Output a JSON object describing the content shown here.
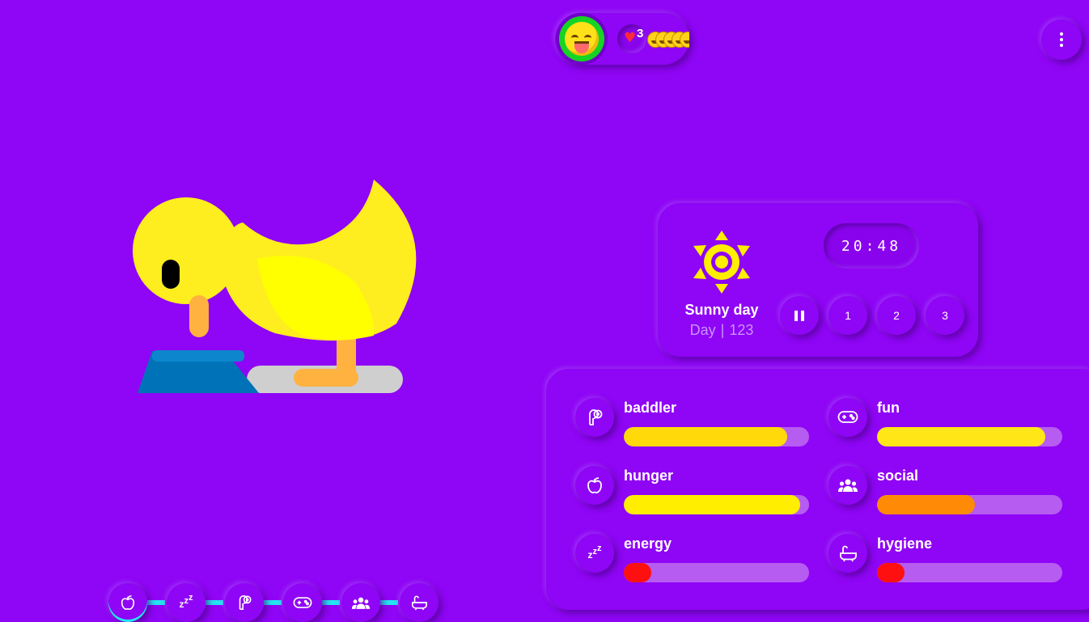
{
  "header": {
    "mood_icon": "grinning-tongue-face-icon",
    "heart_icon": "broken-heart-icon",
    "heart_count": "3",
    "companions_icon": "face-emoji-row-icon",
    "menu_icon": "vertical-dots-icon"
  },
  "pet": {
    "species": "duck",
    "action": "eating",
    "body_color": "#ffee1f",
    "wing_color": "#ffff00",
    "beak_color": "#ffb23f",
    "bowl_color": "#0073b8"
  },
  "weather": {
    "icon": "sun-icon",
    "name": "Sunny day",
    "day_label": "Day",
    "day_separator": "|",
    "day_number": "123",
    "clock": "20:48"
  },
  "speed_controls": {
    "pause_icon": "pause-icon",
    "speeds": [
      "1",
      "2",
      "3"
    ]
  },
  "stats": [
    {
      "key": "baddler",
      "label": "baddler",
      "icon": "toilet-paper-icon",
      "level": 0.88,
      "color": "#ffd90a"
    },
    {
      "key": "fun",
      "label": "fun",
      "icon": "gamepad-icon",
      "level": 0.91,
      "color": "#ffe617"
    },
    {
      "key": "hunger",
      "label": "hunger",
      "icon": "apple-icon",
      "level": 0.95,
      "color": "#ffee00"
    },
    {
      "key": "social",
      "label": "social",
      "icon": "group-icon",
      "level": 0.53,
      "color": "#ff8a05"
    },
    {
      "key": "energy",
      "label": "energy",
      "icon": "zzz-icon",
      "level": 0.15,
      "color": "#ff1010"
    },
    {
      "key": "hygiene",
      "label": "hygiene",
      "icon": "bathtub-icon",
      "level": 0.15,
      "color": "#ff1010"
    }
  ],
  "nav": [
    {
      "key": "hunger",
      "icon": "apple-icon",
      "active": true
    },
    {
      "key": "energy",
      "icon": "zzz-icon",
      "active": false
    },
    {
      "key": "baddler",
      "icon": "toilet-paper-icon",
      "active": false
    },
    {
      "key": "fun",
      "icon": "gamepad-icon",
      "active": false
    },
    {
      "key": "social",
      "icon": "group-icon",
      "active": false
    },
    {
      "key": "hygiene",
      "icon": "bathtub-icon",
      "active": false
    }
  ],
  "colors": {
    "background": "#8f05f5",
    "nav_accent": "#22e6f2",
    "bar_track": "#b65cf0",
    "secondary_text": "#c993ff"
  }
}
